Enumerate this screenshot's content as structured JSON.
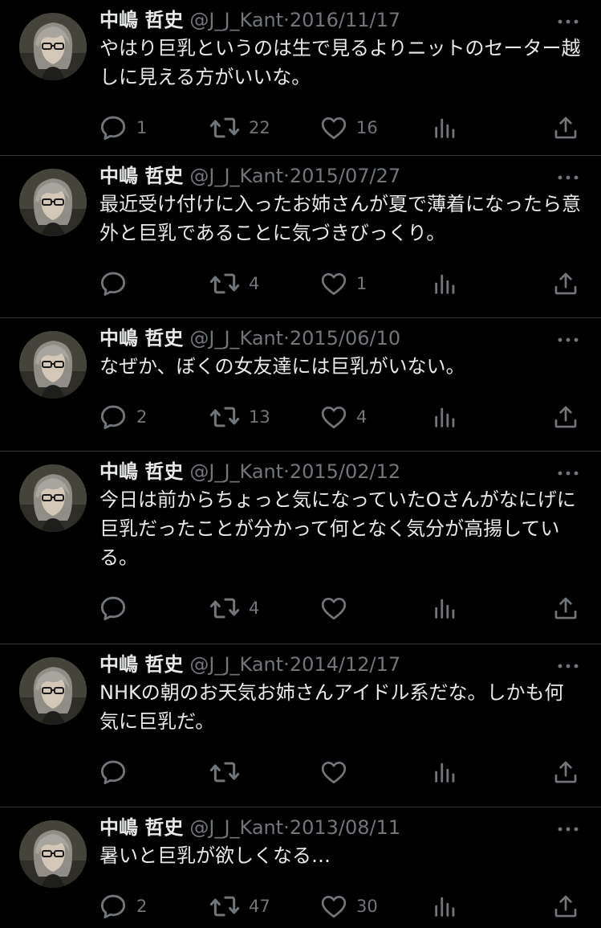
{
  "colors": {
    "background": "#000000",
    "text_primary": "#e7e9ea",
    "text_secondary": "#71767b",
    "divider": "#2f3336"
  },
  "icons": {
    "reply": "speech-bubble-icon",
    "retweet": "retweet-arrows-icon",
    "like": "heart-icon",
    "views": "bar-chart-icon",
    "share": "share-upload-icon",
    "more": "more-dots-icon"
  },
  "tweets": [
    {
      "name": "中嶋 哲史",
      "handle": "@J_J_Kant",
      "separator": "·",
      "date": "2016/11/17",
      "text": "やはり巨乳というのは生で見るよりニットのセーター越しに見える方がいいな。",
      "replies": "1",
      "retweets": "22",
      "likes": "16"
    },
    {
      "name": "中嶋 哲史",
      "handle": "@J_J_Kant",
      "separator": "·",
      "date": "2015/07/27",
      "text": "最近受け付けに入ったお姉さんが夏で薄着になったら意外と巨乳であることに気づきびっくり。",
      "replies": "",
      "retweets": "4",
      "likes": "1"
    },
    {
      "name": "中嶋 哲史",
      "handle": "@J_J_Kant",
      "separator": "·",
      "date": "2015/06/10",
      "text": "なぜか、ぼくの女友達には巨乳がいない。",
      "replies": "2",
      "retweets": "13",
      "likes": "4"
    },
    {
      "name": "中嶋 哲史",
      "handle": "@J_J_Kant",
      "separator": "·",
      "date": "2015/02/12",
      "text": "今日は前からちょっと気になっていたOさんがなにげに巨乳だったことが分かって何となく気分が高揚している。",
      "replies": "",
      "retweets": "4",
      "likes": ""
    },
    {
      "name": "中嶋 哲史",
      "handle": "@J_J_Kant",
      "separator": "·",
      "date": "2014/12/17",
      "text": "NHKの朝のお天気お姉さんアイドル系だな。しかも何気に巨乳だ。",
      "replies": "",
      "retweets": "",
      "likes": ""
    },
    {
      "name": "中嶋 哲史",
      "handle": "@J_J_Kant",
      "separator": "·",
      "date": "2013/08/11",
      "text": "暑いと巨乳が欲しくなる…",
      "replies": "2",
      "retweets": "47",
      "likes": "30"
    }
  ]
}
